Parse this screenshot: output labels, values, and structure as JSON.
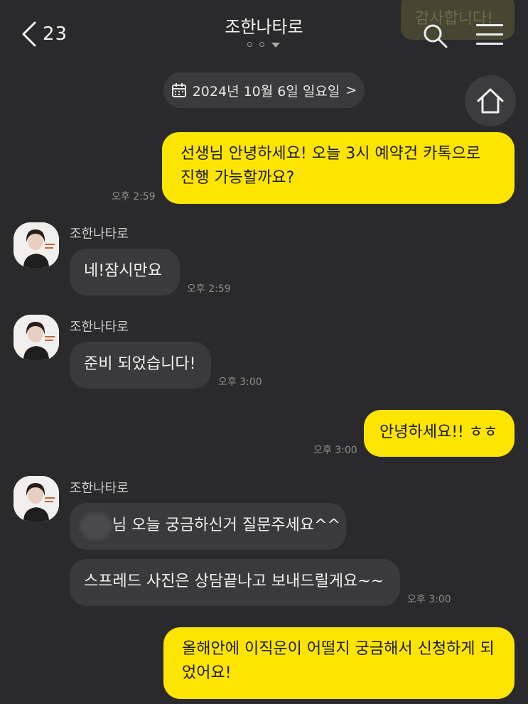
{
  "header": {
    "unread_count": "23",
    "title": "조한나타로",
    "icons": [
      "chevron-left-icon",
      "search-icon",
      "menu-icon",
      "home-icon",
      "calendar-icon"
    ]
  },
  "ghost_message": {
    "text": "감사합니다!"
  },
  "date_pill": {
    "label": "2024년 10월 6일 일요일",
    "arrow": ">"
  },
  "colors": {
    "background": "#2a2a2c",
    "my_bubble": "#fee500",
    "their_bubble": "#3a3a3d",
    "timestamp": "#8e8e8e"
  },
  "messages": [
    {
      "sender": "me",
      "text": "선생님 안녕하세요! 오늘 3시 예약건 카톡으로 진행 가능할까요?",
      "time": "오후 2:59"
    },
    {
      "sender": "조한나타로",
      "text": "네!잠시만요",
      "time": "오후 2:59"
    },
    {
      "sender": "조한나타로",
      "text": "준비 되었습니다!",
      "time": "오후 3:00"
    },
    {
      "sender": "me",
      "text": "안녕하세요!! ㅎㅎ",
      "time": "오후 3:00"
    },
    {
      "sender": "조한나타로",
      "text": "님 오늘 궁금하신거 질문주세요^^"
    },
    {
      "sender": "조한나타로",
      "text": "스프레드 사진은 상담끝나고 보내드릴게요~~",
      "time": "오후 3:00"
    },
    {
      "sender": "me",
      "text": "올해안에 이직운이 어떨지 궁금해서 신청하게 되었어요!"
    }
  ]
}
